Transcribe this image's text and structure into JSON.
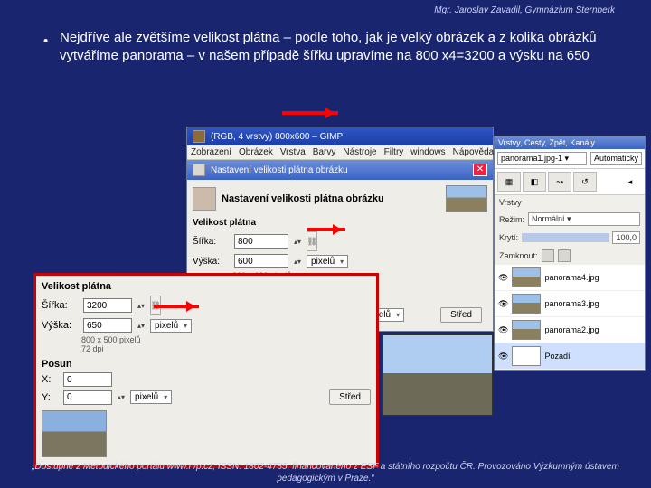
{
  "attribution": "Mgr. Jaroslav Zavadil, Gymnázium Šternberk",
  "bullet": "Nejdříve ale zvětšíme velikost plátna – podle toho, jak je velký  obrázek a z kolika obrázků vytváříme panorama – v našem případě šířku upravíme na 800 x4=3200 a  výsku na 650",
  "gimp": {
    "title": "(RGB, 4 vrstvy) 800x600 – GIMP",
    "menu": [
      "Zobrazení",
      "Obrázek",
      "Vrstva",
      "Barvy",
      "Nástroje",
      "Filtry",
      "windows",
      "Nápověda"
    ],
    "dlg_title": "Nastavení velikosti plátna obrázku",
    "dlg_header": "Nastavení velikosti plátna obrázku",
    "sect_size": "Velikost plátna",
    "w_lbl": "Šířka:",
    "h_lbl": "Výška:",
    "w_val": "800",
    "h_val": "600",
    "unit": "pixelů",
    "info1": "800 x 600 pixelů",
    "info2": "72 dpi",
    "sect_posun": "Posun",
    "btn_center": "Střed"
  },
  "zoom": {
    "sect": "Velikost plátna",
    "w_lbl": "Šířka:",
    "h_lbl": "Výška:",
    "w_val": "3200",
    "h_val": "650",
    "unit": "pixelů",
    "info1": "800 x 500 pixelů",
    "info2": "72 dpi",
    "sect_posun": "Posun",
    "x_lbl": "X:",
    "y_lbl": "Y:",
    "x_val": "0",
    "y_val": "0",
    "btn_center": "Střed"
  },
  "layers": {
    "title": "Vrstvy, Cesty, Zpět, Kanály",
    "image_sel": "panorama1.jpg-1",
    "auto": "Automaticky",
    "sect": "Vrstvy",
    "mode_lbl": "Režim:",
    "mode_val": "Normální",
    "opac_lbl": "Krytí:",
    "opac_val": "100,0",
    "lock_lbl": "Zamknout:",
    "items": [
      "panorama4.jpg",
      "panorama3.jpg",
      "panorama2.jpg",
      "Pozadí"
    ]
  },
  "footer": "„Dostupné z Metodického portálu www.rvp.cz, ISSN: 1802-4785, financovaného z ESF a státního rozpočtu ČR. Provozováno Výzkumným ústavem pedagogickým v Praze.“"
}
